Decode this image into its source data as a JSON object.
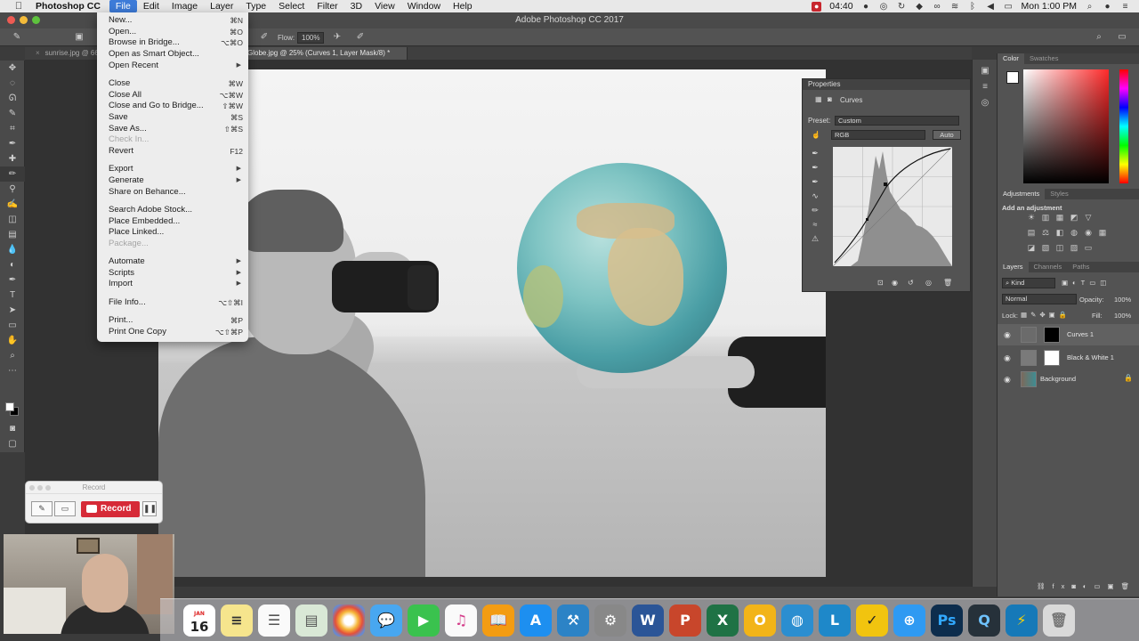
{
  "menubar": {
    "app_name": "Photoshop CC",
    "items": [
      {
        "label": "File",
        "active": true
      },
      {
        "label": "Edit"
      },
      {
        "label": "Image"
      },
      {
        "label": "Layer"
      },
      {
        "label": "Type"
      },
      {
        "label": "Select"
      },
      {
        "label": "Filter"
      },
      {
        "label": "3D"
      },
      {
        "label": "View"
      },
      {
        "label": "Window"
      },
      {
        "label": "Help"
      }
    ],
    "status_time_badge": "04:40",
    "clock": "Mon 1:00 PM"
  },
  "window": {
    "title": "Adobe Photoshop CC 2017"
  },
  "options_bar": {
    "flow_label": "Flow:",
    "flow_value": "100%"
  },
  "doc_tabs": [
    {
      "label": "sunrise.jpg @ 66...",
      "active": false
    },
    {
      "label": "Globe.jpg @ 25% (Curves 1, Layer Mask/8) *",
      "active": true
    }
  ],
  "file_menu": {
    "items": [
      {
        "label": "New...",
        "shortcut": "⌘N"
      },
      {
        "label": "Open...",
        "shortcut": "⌘O"
      },
      {
        "label": "Browse in Bridge...",
        "shortcut": "⌥⌘O"
      },
      {
        "label": "Open as Smart Object...",
        "shortcut": ""
      },
      {
        "label": "Open Recent",
        "shortcut": "",
        "submenu": true
      },
      {
        "sep": true
      },
      {
        "label": "Close",
        "shortcut": "⌘W"
      },
      {
        "label": "Close All",
        "shortcut": "⌥⌘W"
      },
      {
        "label": "Close and Go to Bridge...",
        "shortcut": "⇧⌘W"
      },
      {
        "label": "Save",
        "shortcut": "⌘S"
      },
      {
        "label": "Save As...",
        "shortcut": "⇧⌘S"
      },
      {
        "label": "Check In...",
        "shortcut": "",
        "disabled": true
      },
      {
        "label": "Revert",
        "shortcut": "F12"
      },
      {
        "sep": true
      },
      {
        "label": "Export",
        "shortcut": "",
        "submenu": true
      },
      {
        "label": "Generate",
        "shortcut": "",
        "submenu": true
      },
      {
        "label": "Share on Behance...",
        "shortcut": ""
      },
      {
        "sep": true
      },
      {
        "label": "Search Adobe Stock...",
        "shortcut": ""
      },
      {
        "label": "Place Embedded...",
        "shortcut": ""
      },
      {
        "label": "Place Linked...",
        "shortcut": ""
      },
      {
        "label": "Package...",
        "shortcut": "",
        "disabled": true
      },
      {
        "sep": true
      },
      {
        "label": "Automate",
        "shortcut": "",
        "submenu": true
      },
      {
        "label": "Scripts",
        "shortcut": "",
        "submenu": true
      },
      {
        "label": "Import",
        "shortcut": "",
        "submenu": true
      },
      {
        "sep": true
      },
      {
        "label": "File Info...",
        "shortcut": "⌥⇧⌘I"
      },
      {
        "sep": true
      },
      {
        "label": "Print...",
        "shortcut": "⌘P"
      },
      {
        "label": "Print One Copy",
        "shortcut": "⌥⇧⌘P"
      }
    ]
  },
  "properties_panel": {
    "title": "Properties",
    "adjustment_name": "Curves",
    "preset_label": "Preset:",
    "preset_value": "Custom",
    "channel_value": "RGB",
    "auto_label": "Auto"
  },
  "color_panel": {
    "tabs": [
      "Color",
      "Swatches"
    ]
  },
  "adjustments_panel": {
    "tabs": [
      "Adjustments",
      "Styles"
    ],
    "add_label": "Add an adjustment"
  },
  "layers_panel": {
    "tabs": [
      "Layers",
      "Channels",
      "Paths"
    ],
    "kind_filter": "Kind",
    "blend_mode": "Normal",
    "opacity_label": "Opacity:",
    "opacity_value": "100%",
    "lock_label": "Lock:",
    "fill_label": "Fill:",
    "fill_value": "100%",
    "layers": [
      {
        "name": "Curves 1",
        "selected": true
      },
      {
        "name": "Black & White 1",
        "selected": false
      },
      {
        "name": "Background",
        "selected": false,
        "locked": true
      }
    ]
  },
  "record_widget": {
    "title": "Record",
    "record_label": "Record"
  },
  "dock": {
    "calendar_month": "JAN",
    "calendar_day": "16",
    "apps": [
      "finder-icon",
      "launchpad-icon",
      "calendar-icon",
      "notes-icon",
      "reminders-icon",
      "preview-icon",
      "photos-icon",
      "messages-icon",
      "facetime-icon",
      "itunes-icon",
      "ibooks-icon",
      "appstore-icon",
      "xcode-icon",
      "system-prefs-icon",
      "word-icon",
      "powerpoint-icon",
      "excel-icon",
      "outlook-icon",
      "vpn-icon",
      "lync-icon",
      "ticktick-icon",
      "safari-icon",
      "photoshop-icon",
      "quicktime-icon",
      "bolt-icon",
      "trash-icon"
    ]
  }
}
